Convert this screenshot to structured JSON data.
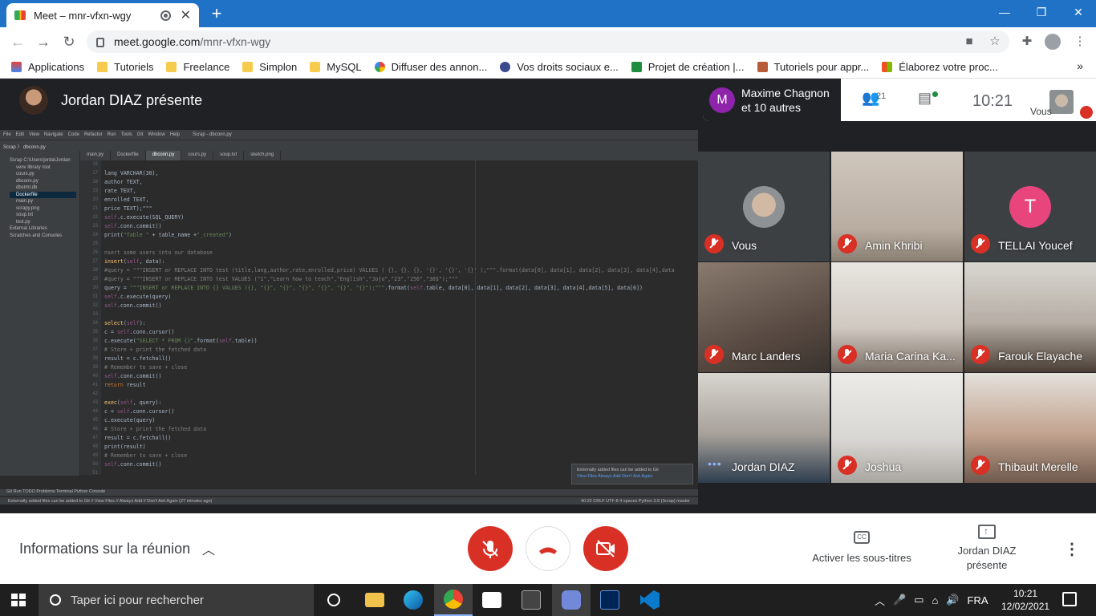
{
  "browser": {
    "tab_title": "Meet – mnr-vfxn-wgy",
    "url_host": "meet.google.com",
    "url_path": "/mnr-vfxn-wgy",
    "bookmarks": [
      "Applications",
      "Tutoriels",
      "Freelance",
      "Simplon",
      "MySQL",
      "Diffuser des annon...",
      "Vos droits sociaux e...",
      "Projet de création |...",
      "Tutoriels pour appr...",
      "Élaborez votre proc..."
    ],
    "bookmarks_more": "»"
  },
  "meet": {
    "presenter_title": "Jordan DIAZ présente",
    "participants_avatar": "M",
    "participants_line1": "Maxime Chagnon",
    "participants_line2": "et 10 autres",
    "people_count": "21",
    "clock": "10:21",
    "self_label": "Vous",
    "tiles": [
      {
        "name": "Vous",
        "muted": true
      },
      {
        "name": "Amin Khribi",
        "muted": true
      },
      {
        "name": "TELLAI Youcef",
        "muted": true,
        "avatar_letter": "T"
      },
      {
        "name": "Marc Landers",
        "muted": true
      },
      {
        "name": "Maria Carina Ka...",
        "muted": true
      },
      {
        "name": "Farouk Elayache",
        "muted": true
      },
      {
        "name": "Jordan DIAZ",
        "muted": false
      },
      {
        "name": "Joshua",
        "muted": true
      },
      {
        "name": "Thibault Merelle",
        "muted": true
      }
    ],
    "meeting_info": "Informations sur la réunion",
    "captions_label": "Activer les sous-titres",
    "present_label_line1": "Jordan DIAZ",
    "present_label_line2": "présente"
  },
  "ide": {
    "menu": [
      "File",
      "Edit",
      "View",
      "Navigate",
      "Code",
      "Refactor",
      "Run",
      "Tools",
      "Git",
      "Window",
      "Help",
      "Scrap - dbconn.py"
    ],
    "crumb": "Scrap  〉 dbconn.py",
    "tabs": [
      "main.py",
      "Dockerfile",
      "dbconn.py",
      "cours.py",
      "soup.txt",
      "sketch.png"
    ],
    "tree": [
      "Scrap  C:\\Users\\jorda\\Jordan",
      "venv  library root",
      "cours.py",
      "dbconn.py",
      "dbstmt.db",
      "Dockerfile",
      "main.py",
      "scrapy.png",
      "soup.txt",
      "test.py",
      "External Libraries",
      "Scratches and Consoles"
    ],
    "line_numbers": [
      "16",
      "17",
      "18",
      "19",
      "20",
      "21",
      "22",
      "23",
      "24",
      "25",
      "26",
      "27",
      "28",
      "29",
      "30",
      "31",
      "32",
      "33",
      "34",
      "35",
      "36",
      "37",
      "38",
      "39",
      "40",
      "41",
      "42",
      "43",
      "44",
      "45",
      "46",
      "47",
      "48",
      "49",
      "50",
      "51"
    ],
    "notification_text": "Externally added files can be added to Git",
    "notification_links": "View Files    Always Add    Don't Ask Again",
    "bottom_tools": "Git    Run    TODO    Problems    Terminal    Python Console",
    "status_left": "Externally added files can be added to Git // View Files // Always Add // Don't Ask Again (27 minutes ago)",
    "status_right": "40:22   CRLF   UTF-8   4 spaces   Python 3.9 (Scrap)   master"
  },
  "taskbar": {
    "search_placeholder": "Taper ici pour rechercher",
    "language": "FRA",
    "time": "10:21",
    "date": "12/02/2021"
  }
}
